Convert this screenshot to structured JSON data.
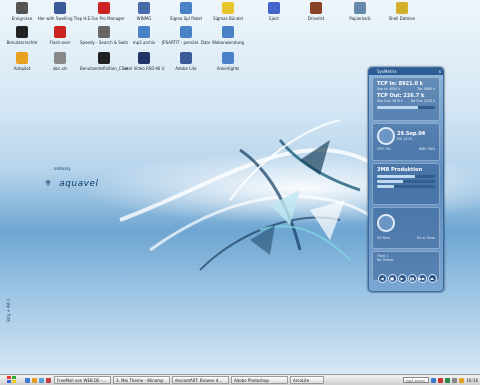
{
  "desktop_icons": [
    {
      "label": "Ereignisse",
      "color": "#555555",
      "icon": "shortcut-icon"
    },
    {
      "label": "Her with Swelling Trap",
      "color": "#3a5a9a",
      "icon": "shortcut-icon"
    },
    {
      "label": "H.E.Fan Pro Manager",
      "color": "#cc2222",
      "icon": "shortcut-icon"
    },
    {
      "label": "WINMG",
      "color": "#4a6aaa",
      "icon": "folder-icon"
    },
    {
      "label": "Sigma Spl Paket",
      "color": "#4a82c8",
      "icon": "folder-icon"
    },
    {
      "label": "Sigmas Bündel",
      "color": "#e8c52c",
      "icon": "folder-icon"
    },
    {
      "label": "Eject",
      "color": "#4466cc",
      "icon": "app-icon"
    },
    {
      "label": "Drivelist",
      "color": "#884422",
      "icon": "app-icon"
    },
    {
      "label": "Papierkorb",
      "color": "#6688aa",
      "icon": "recycle-bin-icon"
    },
    {
      "label": "Shell Dateien",
      "color": "#d4b02a",
      "icon": "folder-icon"
    },
    {
      "label": "Benutzerrechte",
      "color": "#222222",
      "icon": "shortcut-icon"
    },
    {
      "label": "Flash-over",
      "color": "#cc2222",
      "icon": "app-icon"
    },
    {
      "label": "Speedy - Search & Switcher",
      "color": "#666666",
      "icon": "app-icon"
    },
    {
      "label": "mp3 archiv",
      "color": "#4a82c8",
      "icon": "folder-icon"
    },
    {
      "label": "JPSARTIT - persönl. Dateien",
      "color": "#4a82c8",
      "icon": "folder-icon"
    },
    {
      "label": "Webanwendung",
      "color": "#4a82c8",
      "icon": "folder-icon"
    },
    {
      "label": "Aimpilot",
      "color": "#e8a020",
      "icon": "app-icon"
    },
    {
      "label": "abc.xls",
      "color": "#888888",
      "icon": "file-icon"
    },
    {
      "label": "Benutzerdefinition_CS.exe",
      "color": "#222222",
      "icon": "shortcut-icon"
    },
    {
      "label": "Intel Video RSO-NI U",
      "color": "#223366",
      "icon": "app-icon"
    },
    {
      "label": "Adobe Lite",
      "color": "#3a5a9a",
      "icon": "app-icon"
    },
    {
      "label": "Ankerlights",
      "color": "#4a82c8",
      "icon": "app-icon"
    }
  ],
  "brand": {
    "small": "ordinary",
    "big": "aquavel",
    "fleur": "⚜"
  },
  "side_text": "Strg + Alt-1",
  "widget": {
    "title": "SysMetrix",
    "close": "x",
    "tcp_in": "TCP In: 8921.0 k",
    "tcp_in_sub1": "Sep In: 4050 k",
    "tcp_in_sub2": "Tot: 5690 k",
    "tcp_out": "TCP Out: 226.7 k",
    "tcp_out_sub1": "Sep Out: 3870 k",
    "tcp_out_sub2": "Tot Out: 2235 k",
    "date": "29.Sep.04",
    "time": "MO 14:31",
    "cpu": "CPU: 4%",
    "mem": "RAM: 58%",
    "service": "3MB Produktion",
    "bars": [
      0.65,
      0.45,
      0.3
    ],
    "disk_c": "CD Rom",
    "disk_d": "3% In Trash",
    "track": "Track 1",
    "track_sub": "No Theme",
    "buttons": [
      "◀",
      "■",
      "▶",
      "▮▮",
      "▶▶",
      "⏏"
    ]
  },
  "taskbar": {
    "start": "start",
    "tasks": [
      "FreeMail von WEB.DE -...",
      "3. Mai Theme - Winamp",
      "deviantART: Browse d...",
      "Adobe Photoshop",
      "ArcoLite"
    ],
    "search": "mp3 archiv",
    "clock": "16:16"
  },
  "colors": {
    "taskbar": "#cfcfcf",
    "widget": "#5d8cc0",
    "accent": "#0c3d6e"
  }
}
